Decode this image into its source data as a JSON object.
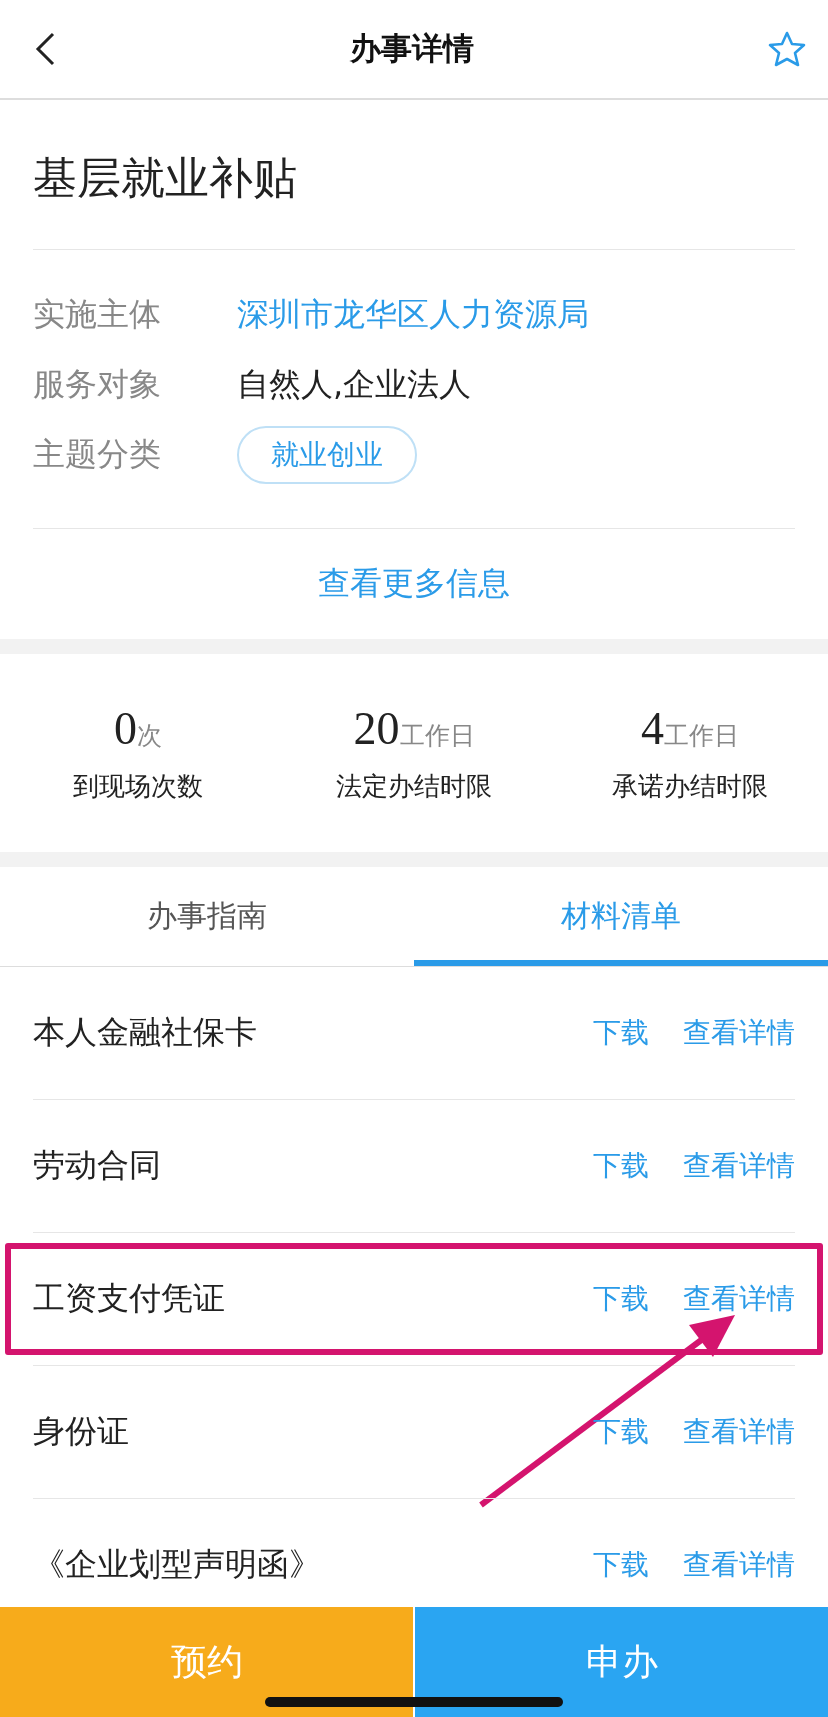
{
  "header": {
    "title": "办事详情"
  },
  "service": {
    "title": "基层就业补贴",
    "info": [
      {
        "kind": "link",
        "label": "实施主体",
        "value": "深圳市龙华区人力资源局"
      },
      {
        "kind": "text",
        "label": "服务对象",
        "value": "自然人,企业法人"
      },
      {
        "kind": "tag",
        "label": "主题分类",
        "value": "就业创业"
      }
    ],
    "more_link": "查看更多信息"
  },
  "stats": [
    {
      "number": "0",
      "unit": "次",
      "label": "到现场次数"
    },
    {
      "number": "20",
      "unit": "工作日",
      "label": "法定办结时限"
    },
    {
      "number": "4",
      "unit": "工作日",
      "label": "承诺办结时限"
    }
  ],
  "tabs": [
    {
      "label": "办事指南",
      "selected": false
    },
    {
      "label": "材料清单",
      "selected": true
    }
  ],
  "materials": [
    {
      "name": "本人金融社保卡",
      "download": "下载",
      "details": "查看详情",
      "highlighted": false
    },
    {
      "name": "劳动合同",
      "download": "下载",
      "details": "查看详情",
      "highlighted": false
    },
    {
      "name": "工资支付凭证",
      "download": "下载",
      "details": "查看详情",
      "highlighted": true
    },
    {
      "name": "身份证",
      "download": "下载",
      "details": "查看详情",
      "highlighted": false
    },
    {
      "name": "《企业划型声明函》",
      "download": "下载",
      "details": "查看详情",
      "highlighted": false
    }
  ],
  "actions": [
    {
      "kind": "appointment",
      "label": "预约"
    },
    {
      "kind": "apply",
      "label": "申办"
    }
  ]
}
